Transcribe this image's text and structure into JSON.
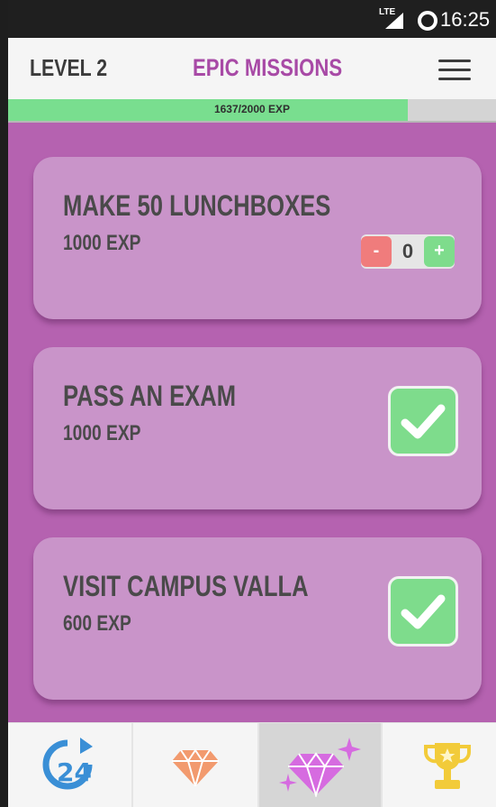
{
  "status_bar": {
    "network": "LTE",
    "time": "16:25"
  },
  "header": {
    "level": "LEVEL 2",
    "title": "EPIC MISSIONS",
    "menu_icon": "hamburger-menu-icon"
  },
  "progress": {
    "label": "1637/2000 EXP",
    "current": 1637,
    "max": 2000,
    "fill_color": "#79de8f"
  },
  "missions": [
    {
      "title": "MAKE 50 LUNCHBOXES",
      "exp": "1000 EXP",
      "control": "stepper",
      "stepper": {
        "minus": "-",
        "value": "0",
        "plus": "+"
      }
    },
    {
      "title": "PASS AN EXAM",
      "exp": "1000 EXP",
      "control": "checkbox",
      "checked": true
    },
    {
      "title": "VISIT CAMPUS VALLA",
      "exp": "600 EXP",
      "control": "checkbox",
      "checked": true
    }
  ],
  "bottom_nav": {
    "tabs": [
      {
        "icon": "refresh-24-icon",
        "label": "24",
        "active": false
      },
      {
        "icon": "diamond-icon",
        "active": false
      },
      {
        "icon": "sparkle-diamond-icon",
        "active": true
      },
      {
        "icon": "trophy-icon",
        "active": false
      }
    ]
  },
  "colors": {
    "background": "#b562b0",
    "card": "#c994c9",
    "title_accent": "#a84aa6",
    "success": "#7edc8c",
    "danger": "#f07c7c"
  }
}
